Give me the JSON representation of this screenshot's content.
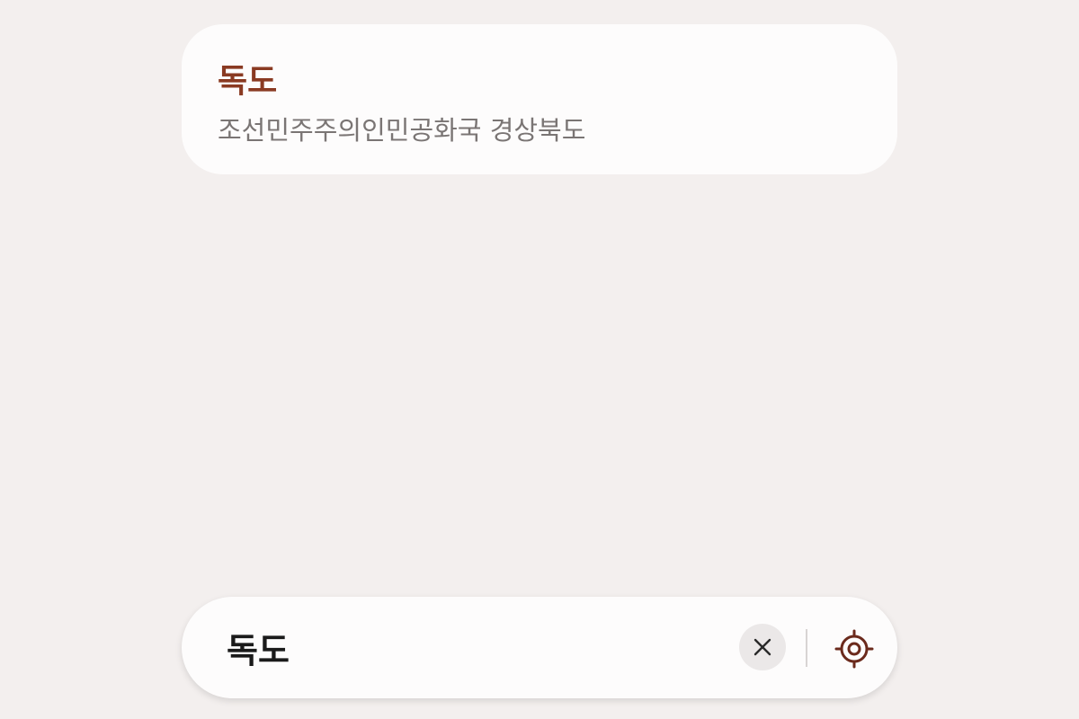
{
  "result": {
    "title": "독도",
    "subtitle": "조선민주주의인민공화국 경상북도"
  },
  "search": {
    "value": "독도"
  },
  "icons": {
    "clear": "close-icon",
    "locate": "my-location-icon"
  },
  "colors": {
    "background": "#f3efee",
    "card": "#fdfcfc",
    "title_accent": "#8a3a22",
    "subtitle": "#7a7574",
    "locate_icon": "#6b2a1c"
  }
}
